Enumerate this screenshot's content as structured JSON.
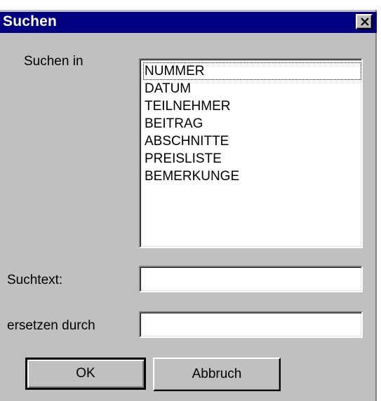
{
  "dialog": {
    "title": "Suchen",
    "close_label": "×"
  },
  "search_in": {
    "label": "Suchen in",
    "items": [
      "NUMMER",
      "DATUM",
      "TEILNEHMER",
      "BEITRAG",
      "ABSCHNITTE",
      "PREISLISTE",
      "BEMERKUNGE"
    ],
    "focused_item": "NUMMER"
  },
  "suchtext": {
    "label": "Suchtext:",
    "value": ""
  },
  "ersetzen": {
    "label": "ersetzen durch",
    "value": ""
  },
  "buttons": {
    "ok": "OK",
    "cancel": "Abbruch"
  },
  "colors": {
    "titlebar": "#000080",
    "face": "#c0c0c0"
  }
}
